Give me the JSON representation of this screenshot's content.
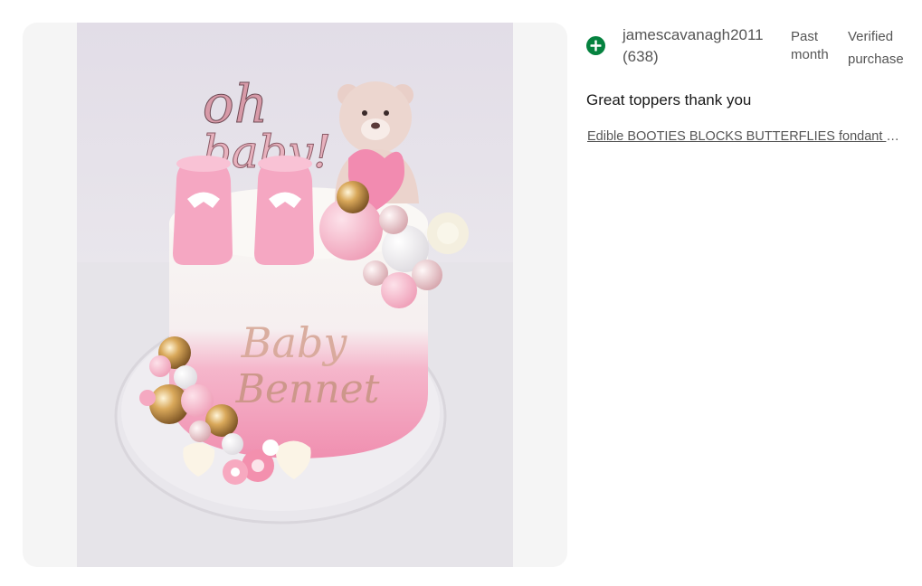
{
  "review": {
    "username": "jamescavanagh2011",
    "feedback_score": "(638)",
    "time_line1": "Past",
    "time_line2": "month",
    "verified_line1": "Verified",
    "verified_line2": "purchase",
    "text": "Great toppers thank you",
    "item_title": "Edible BOOTIES BLOCKS BUTTERFLIES fondant cake toppers"
  },
  "photo": {
    "topper_text": "oh baby!",
    "cake_text_line1": "Baby",
    "cake_text_line2": "Bennet"
  },
  "colors": {
    "positive_icon": "#05823f",
    "panel_bg": "#f5f5f5"
  },
  "icons": {
    "positive": "plus-circle-icon"
  }
}
